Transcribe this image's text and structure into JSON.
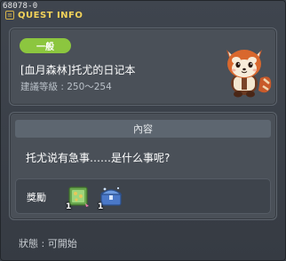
{
  "window": {
    "quest_id": "68078-0",
    "title": "QUEST INFO",
    "title_icon": "scroll-icon"
  },
  "header": {
    "badge": "一般",
    "badge_color": "#8cc63f",
    "quest_name": "[血月森林]托尤的日记本",
    "level_requirement": "建議等級 : 250～254",
    "npc_icon": "red-panda-npc-icon"
  },
  "content": {
    "section_title": "內容",
    "description": "托尤说有急事……是什么事呢?"
  },
  "rewards": {
    "label": "獎勵",
    "items": [
      {
        "icon": "green-scroll-icon",
        "count": "1"
      },
      {
        "icon": "blue-chest-icon",
        "count": "1"
      }
    ]
  },
  "status": {
    "text": "狀態 : 可開始"
  }
}
